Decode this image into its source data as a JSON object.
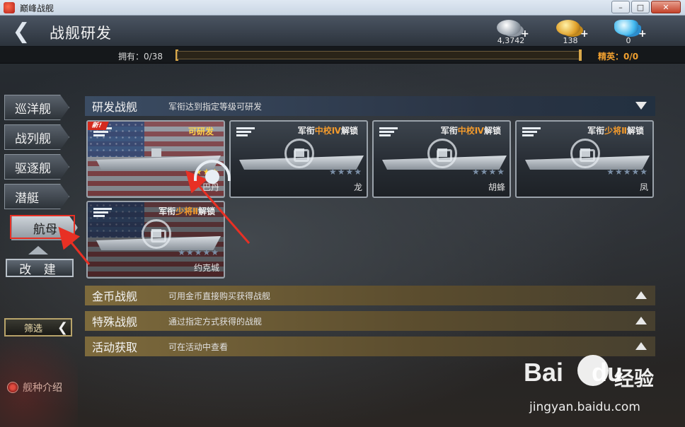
{
  "window": {
    "title": "巅峰战舰",
    "min_label": "–",
    "max_label": "□",
    "close_label": "✕"
  },
  "header": {
    "back_icon": "chevron-left-icon",
    "back_glyph": "❮",
    "title": "战舰研发",
    "currencies": [
      {
        "name": "silver",
        "icon": "silver-coin-icon",
        "value": "4,3742",
        "plus": "+"
      },
      {
        "name": "gold",
        "icon": "gold-coin-icon",
        "value": "138",
        "plus": "+"
      },
      {
        "name": "diamond",
        "icon": "diamond-icon",
        "value": "0",
        "plus": "+"
      }
    ]
  },
  "ownership": {
    "label": "拥有：0/38",
    "progress": 0,
    "elite_label": "精英：0/0"
  },
  "sidebar": {
    "tabs": [
      {
        "label": "巡洋舰",
        "active": false
      },
      {
        "label": "战列舰",
        "active": false
      },
      {
        "label": "驱逐舰",
        "active": false
      },
      {
        "label": "潜艇",
        "active": false
      },
      {
        "label": "航母",
        "active": true
      }
    ],
    "refit_label": "改 建",
    "filter_label": "筛选",
    "filter_chevron": "❮",
    "intro_label": "舰种介绍"
  },
  "sections": {
    "research": {
      "title": "研发战舰",
      "desc": "军衔达到指定等级可研发"
    },
    "gold": {
      "title": "金币战舰",
      "desc": "可用金币直接购买获得战舰"
    },
    "special": {
      "title": "特殊战舰",
      "desc": "通过指定方式获得的战舰"
    },
    "event": {
      "title": "活动获取",
      "desc": "可在活动中查看"
    }
  },
  "ships": [
    {
      "name": "巴丹",
      "status": "可研发",
      "new_badge": "新!",
      "stars": "★★★",
      "stars_lit": true,
      "locked": false
    },
    {
      "name": "龙",
      "unlock_prefix": "军衔",
      "unlock_rank": "中校Ⅳ",
      "unlock_suffix": "解锁",
      "stars": "★★★★",
      "stars_lit": false,
      "locked": true
    },
    {
      "name": "胡蜂",
      "unlock_prefix": "军衔",
      "unlock_rank": "中校Ⅳ",
      "unlock_suffix": "解锁",
      "stars": "★★★★",
      "stars_lit": false,
      "locked": true
    },
    {
      "name": "凤",
      "unlock_prefix": "军衔",
      "unlock_rank": "少将Ⅱ",
      "unlock_suffix": "解锁",
      "stars": "★★★★★",
      "stars_lit": false,
      "locked": true
    },
    {
      "name": "约克城",
      "unlock_prefix": "军衔",
      "unlock_rank": "少将Ⅱ",
      "unlock_suffix": "解锁",
      "stars": "★★★★★",
      "stars_lit": false,
      "locked": true
    }
  ],
  "colors": {
    "accent_orange": "#f29a2c",
    "star_gold": "#ffd23a",
    "annotation_red": "#e83024"
  },
  "watermark": {
    "logo": "Bai",
    "logo_suffix": "du",
    "cn": "经验",
    "url": "jingyan.baidu.com"
  }
}
